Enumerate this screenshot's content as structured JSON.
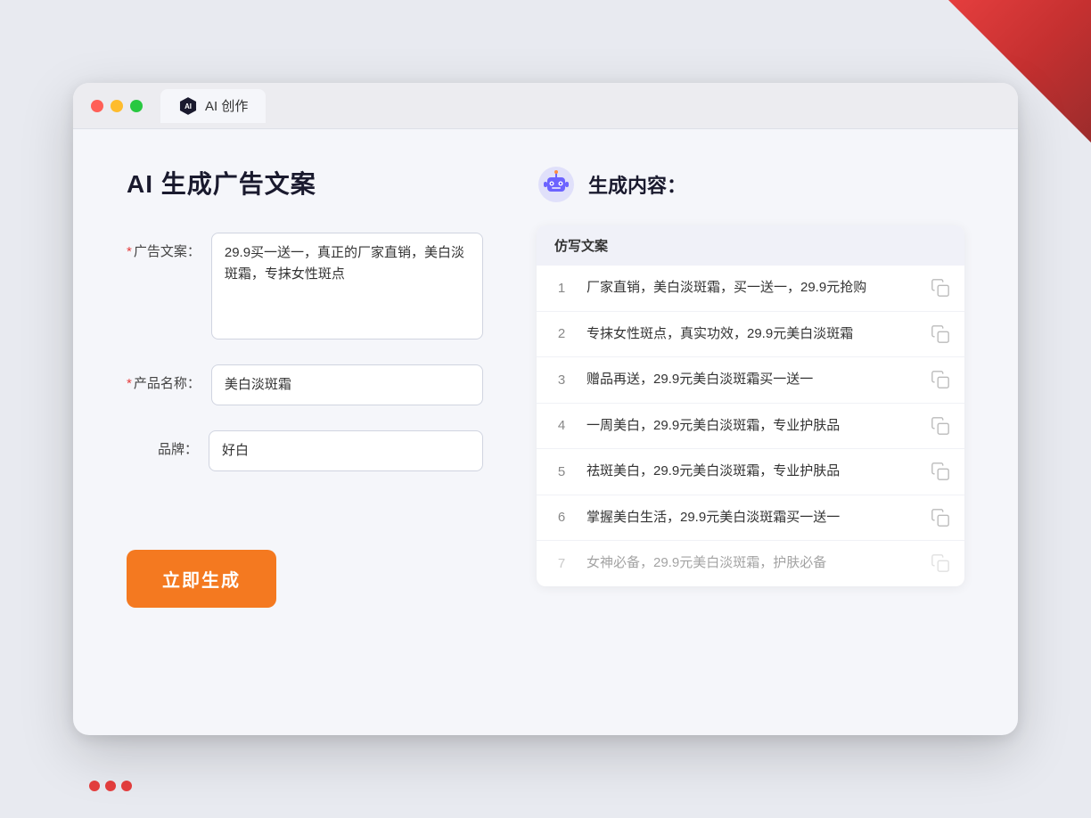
{
  "window": {
    "tab_label": "AI 创作"
  },
  "left_panel": {
    "title": "AI 生成广告文案",
    "ad_copy_label": "广告文案：",
    "ad_copy_required": "*",
    "ad_copy_value": "29.9买一送一，真正的厂家直销，美白淡斑霜，专抹女性斑点",
    "product_name_label": "产品名称：",
    "product_name_required": "*",
    "product_name_value": "美白淡斑霜",
    "brand_label": "品牌：",
    "brand_value": "好白",
    "submit_label": "立即生成"
  },
  "right_panel": {
    "title": "生成内容：",
    "column_header": "仿写文案",
    "results": [
      {
        "num": "1",
        "text": "厂家直销，美白淡斑霜，买一送一，29.9元抢购",
        "faded": false
      },
      {
        "num": "2",
        "text": "专抹女性斑点，真实功效，29.9元美白淡斑霜",
        "faded": false
      },
      {
        "num": "3",
        "text": "赠品再送，29.9元美白淡斑霜买一送一",
        "faded": false
      },
      {
        "num": "4",
        "text": "一周美白，29.9元美白淡斑霜，专业护肤品",
        "faded": false
      },
      {
        "num": "5",
        "text": "祛斑美白，29.9元美白淡斑霜，专业护肤品",
        "faded": false
      },
      {
        "num": "6",
        "text": "掌握美白生活，29.9元美白淡斑霜买一送一",
        "faded": false
      },
      {
        "num": "7",
        "text": "女神必备，29.9元美白淡斑霜，护肤必备",
        "faded": true
      }
    ]
  }
}
